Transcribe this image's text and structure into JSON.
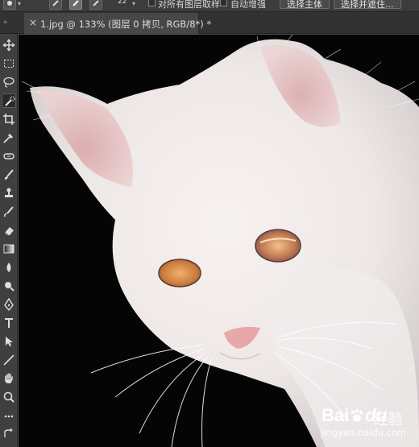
{
  "options_bar": {
    "size_value": "22",
    "sample_all_layers_label": "对所有图层取样",
    "auto_enhance_label": "自动增强",
    "select_subject_label": "选择主体",
    "select_mask_label": "选择并遮住..."
  },
  "document_tab": {
    "close_glyph": "×",
    "title": "1.jpg @ 133% (图层 0 拷贝, RGB/8*) *"
  },
  "toolbar": {
    "tools": [
      "move-tool",
      "marquee-tool",
      "lasso-tool",
      "quick-selection-tool",
      "crop-tool",
      "eyedropper-tool",
      "healing-brush-tool",
      "brush-tool",
      "clone-stamp-tool",
      "history-brush-tool",
      "eraser-tool",
      "gradient-tool",
      "blur-tool",
      "dodge-tool",
      "pen-tool",
      "type-tool",
      "path-selection-tool",
      "line-tool",
      "hand-tool",
      "zoom-tool",
      "more-tools",
      "swap-colors"
    ],
    "active_tool": "quick-selection-tool"
  },
  "canvas": {
    "subject": "white cat on black background"
  },
  "watermark": {
    "brand_a": "Bai",
    "brand_b": "du",
    "brand_suffix": "经验",
    "url": "jingyan.baidu.com"
  }
}
